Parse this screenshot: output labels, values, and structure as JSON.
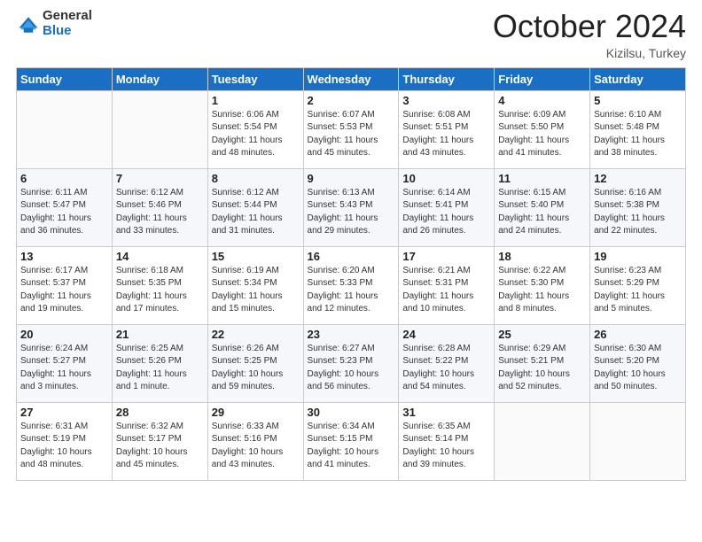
{
  "header": {
    "logo_general": "General",
    "logo_blue": "Blue",
    "month_title": "October 2024",
    "location": "Kizilsu, Turkey"
  },
  "days_of_week": [
    "Sunday",
    "Monday",
    "Tuesday",
    "Wednesday",
    "Thursday",
    "Friday",
    "Saturday"
  ],
  "weeks": [
    [
      {
        "day": "",
        "info": ""
      },
      {
        "day": "",
        "info": ""
      },
      {
        "day": "1",
        "info": "Sunrise: 6:06 AM\nSunset: 5:54 PM\nDaylight: 11 hours and 48 minutes."
      },
      {
        "day": "2",
        "info": "Sunrise: 6:07 AM\nSunset: 5:53 PM\nDaylight: 11 hours and 45 minutes."
      },
      {
        "day": "3",
        "info": "Sunrise: 6:08 AM\nSunset: 5:51 PM\nDaylight: 11 hours and 43 minutes."
      },
      {
        "day": "4",
        "info": "Sunrise: 6:09 AM\nSunset: 5:50 PM\nDaylight: 11 hours and 41 minutes."
      },
      {
        "day": "5",
        "info": "Sunrise: 6:10 AM\nSunset: 5:48 PM\nDaylight: 11 hours and 38 minutes."
      }
    ],
    [
      {
        "day": "6",
        "info": "Sunrise: 6:11 AM\nSunset: 5:47 PM\nDaylight: 11 hours and 36 minutes."
      },
      {
        "day": "7",
        "info": "Sunrise: 6:12 AM\nSunset: 5:46 PM\nDaylight: 11 hours and 33 minutes."
      },
      {
        "day": "8",
        "info": "Sunrise: 6:12 AM\nSunset: 5:44 PM\nDaylight: 11 hours and 31 minutes."
      },
      {
        "day": "9",
        "info": "Sunrise: 6:13 AM\nSunset: 5:43 PM\nDaylight: 11 hours and 29 minutes."
      },
      {
        "day": "10",
        "info": "Sunrise: 6:14 AM\nSunset: 5:41 PM\nDaylight: 11 hours and 26 minutes."
      },
      {
        "day": "11",
        "info": "Sunrise: 6:15 AM\nSunset: 5:40 PM\nDaylight: 11 hours and 24 minutes."
      },
      {
        "day": "12",
        "info": "Sunrise: 6:16 AM\nSunset: 5:38 PM\nDaylight: 11 hours and 22 minutes."
      }
    ],
    [
      {
        "day": "13",
        "info": "Sunrise: 6:17 AM\nSunset: 5:37 PM\nDaylight: 11 hours and 19 minutes."
      },
      {
        "day": "14",
        "info": "Sunrise: 6:18 AM\nSunset: 5:35 PM\nDaylight: 11 hours and 17 minutes."
      },
      {
        "day": "15",
        "info": "Sunrise: 6:19 AM\nSunset: 5:34 PM\nDaylight: 11 hours and 15 minutes."
      },
      {
        "day": "16",
        "info": "Sunrise: 6:20 AM\nSunset: 5:33 PM\nDaylight: 11 hours and 12 minutes."
      },
      {
        "day": "17",
        "info": "Sunrise: 6:21 AM\nSunset: 5:31 PM\nDaylight: 11 hours and 10 minutes."
      },
      {
        "day": "18",
        "info": "Sunrise: 6:22 AM\nSunset: 5:30 PM\nDaylight: 11 hours and 8 minutes."
      },
      {
        "day": "19",
        "info": "Sunrise: 6:23 AM\nSunset: 5:29 PM\nDaylight: 11 hours and 5 minutes."
      }
    ],
    [
      {
        "day": "20",
        "info": "Sunrise: 6:24 AM\nSunset: 5:27 PM\nDaylight: 11 hours and 3 minutes."
      },
      {
        "day": "21",
        "info": "Sunrise: 6:25 AM\nSunset: 5:26 PM\nDaylight: 11 hours and 1 minute."
      },
      {
        "day": "22",
        "info": "Sunrise: 6:26 AM\nSunset: 5:25 PM\nDaylight: 10 hours and 59 minutes."
      },
      {
        "day": "23",
        "info": "Sunrise: 6:27 AM\nSunset: 5:23 PM\nDaylight: 10 hours and 56 minutes."
      },
      {
        "day": "24",
        "info": "Sunrise: 6:28 AM\nSunset: 5:22 PM\nDaylight: 10 hours and 54 minutes."
      },
      {
        "day": "25",
        "info": "Sunrise: 6:29 AM\nSunset: 5:21 PM\nDaylight: 10 hours and 52 minutes."
      },
      {
        "day": "26",
        "info": "Sunrise: 6:30 AM\nSunset: 5:20 PM\nDaylight: 10 hours and 50 minutes."
      }
    ],
    [
      {
        "day": "27",
        "info": "Sunrise: 6:31 AM\nSunset: 5:19 PM\nDaylight: 10 hours and 48 minutes."
      },
      {
        "day": "28",
        "info": "Sunrise: 6:32 AM\nSunset: 5:17 PM\nDaylight: 10 hours and 45 minutes."
      },
      {
        "day": "29",
        "info": "Sunrise: 6:33 AM\nSunset: 5:16 PM\nDaylight: 10 hours and 43 minutes."
      },
      {
        "day": "30",
        "info": "Sunrise: 6:34 AM\nSunset: 5:15 PM\nDaylight: 10 hours and 41 minutes."
      },
      {
        "day": "31",
        "info": "Sunrise: 6:35 AM\nSunset: 5:14 PM\nDaylight: 10 hours and 39 minutes."
      },
      {
        "day": "",
        "info": ""
      },
      {
        "day": "",
        "info": ""
      }
    ]
  ]
}
